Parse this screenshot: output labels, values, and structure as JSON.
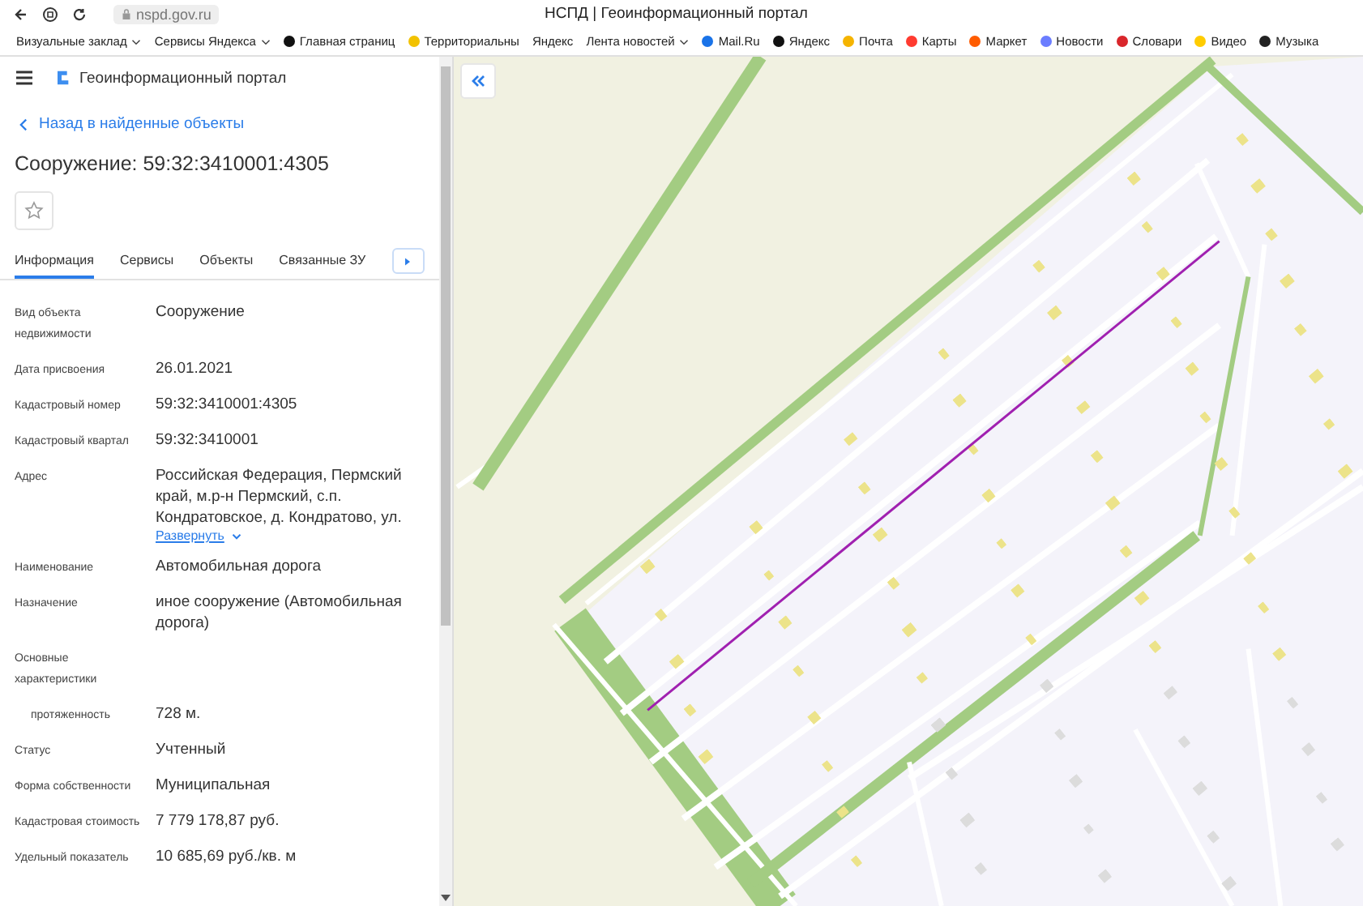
{
  "browser": {
    "address": "nspd.gov.ru",
    "title": "НСПД | Геоинформационный портал",
    "bookmarks": [
      {
        "label": "Визуальные заклад",
        "has_menu": true
      },
      {
        "label": "Сервисы Яндекса",
        "has_menu": true
      },
      {
        "label": "Главная страниц",
        "has_menu": false,
        "color": "#111111"
      },
      {
        "label": "Территориальны",
        "has_menu": false,
        "color": "#f2c200"
      },
      {
        "label": "Яндекс",
        "has_menu": false
      },
      {
        "label": "Лента новостей",
        "has_menu": true
      },
      {
        "label": "Mail.Ru",
        "has_menu": false,
        "color": "#1a73e8"
      },
      {
        "label": "Яндекс",
        "has_menu": false,
        "color": "#111111"
      },
      {
        "label": "Почта",
        "has_menu": false,
        "color": "#f5b400"
      },
      {
        "label": "Карты",
        "has_menu": false,
        "color": "#ff3b30"
      },
      {
        "label": "Маркет",
        "has_menu": false,
        "color": "#ff5c00"
      },
      {
        "label": "Новости",
        "has_menu": false,
        "color": "#6b7dff"
      },
      {
        "label": "Словари",
        "has_menu": false,
        "color": "#d9262b"
      },
      {
        "label": "Видео",
        "has_menu": false,
        "color": "#ffcc00"
      },
      {
        "label": "Музыка",
        "has_menu": false,
        "color": "#222222"
      }
    ]
  },
  "portal": {
    "title": "Геоинформационный портал"
  },
  "back_link": "Назад в найденные объекты",
  "object_title": "Сооружение: 59:32:3410001:4305",
  "favorite": {
    "on": false
  },
  "tabs": [
    {
      "label": "Информация",
      "selected": true
    },
    {
      "label": "Сервисы",
      "selected": false
    },
    {
      "label": "Объекты",
      "selected": false
    },
    {
      "label": "Связанные ЗУ",
      "selected": false
    }
  ],
  "fields": [
    {
      "kind": "field",
      "label": "Вид объекта недвижимости",
      "value": "Сооружение"
    },
    {
      "kind": "field",
      "label": "Дата присвоения",
      "value": "26.01.2021"
    },
    {
      "kind": "field",
      "label": "Кадастровый номер",
      "value": "59:32:3410001:4305"
    },
    {
      "kind": "field",
      "label": "Кадастровый квартал",
      "value": "59:32:3410001"
    },
    {
      "kind": "field",
      "label": "Адрес",
      "value": "Российская Федерация, Пермский край, м.р-н Пермский, с.п. Кондратовское, д. Кондратово, ул.",
      "expand_link": "Развернуть"
    },
    {
      "kind": "field",
      "label": "Наименование",
      "value": "Автомобильная дорога"
    },
    {
      "kind": "field",
      "label": "Назначение",
      "value": "иное сооружение (Автомобильная дорога)"
    },
    {
      "kind": "group",
      "label": "Основные характеристики"
    },
    {
      "kind": "sub",
      "label": "протяженность",
      "value": "728 м."
    },
    {
      "kind": "field",
      "label": "Статус",
      "value": "Учтенный"
    },
    {
      "kind": "field",
      "label": "Форма собственности",
      "value": "Муниципальная"
    },
    {
      "kind": "field",
      "label": "Кадастровая стоимость",
      "value": "7 779 178,87 руб."
    },
    {
      "kind": "field",
      "label": "Удельный показатель",
      "value": "10 685,69 руб./кв. м"
    }
  ]
}
